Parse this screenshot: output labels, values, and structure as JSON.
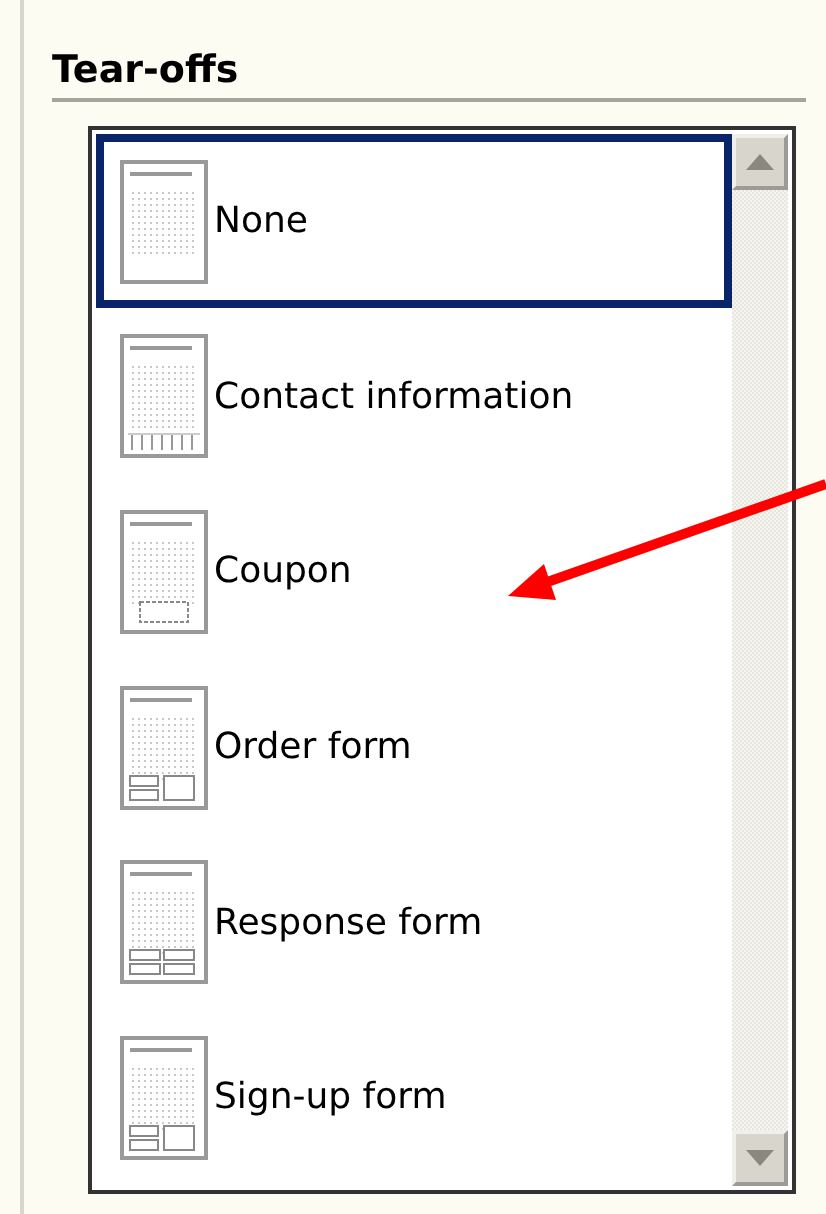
{
  "section": {
    "title": "Tear-offs"
  },
  "items": [
    {
      "label": "None",
      "kind": "none",
      "selected": true
    },
    {
      "label": "Contact information",
      "kind": "contact",
      "selected": false
    },
    {
      "label": "Coupon",
      "kind": "coupon",
      "selected": false
    },
    {
      "label": "Order form",
      "kind": "order",
      "selected": false
    },
    {
      "label": "Response form",
      "kind": "response",
      "selected": false
    },
    {
      "label": "Sign-up form",
      "kind": "signup",
      "selected": false
    }
  ]
}
